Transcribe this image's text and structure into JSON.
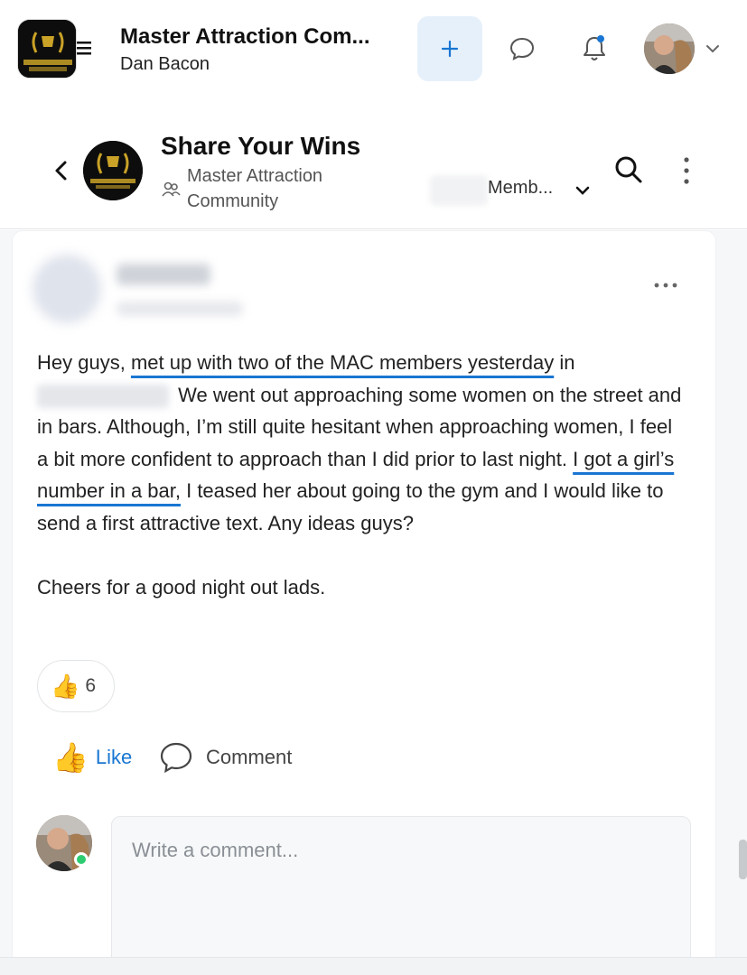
{
  "app": {
    "title": "Master Attraction Com...",
    "user_name": "Dan Bacon",
    "logo_text": "MASTER ATTRACTION COMMUNITY"
  },
  "group": {
    "title": "Share Your Wins",
    "community": "Master Attraction Community",
    "members_label": "Memb..."
  },
  "post": {
    "lines": {
      "p1_a": "Hey guys, ",
      "p1_hl1": "met up with two of the MAC members yesterday",
      "p1_b": " in",
      "p1_c": " We went out approaching some women on the street and in bars. Although, I’m still quite hesitant when approaching women, I feel a bit more confident to approach than I did prior to last night. ",
      "p1_hl2": "I got a girl’s number in a bar,",
      "p1_d": " I teased her about going to the gym and I would like to send a first attractive text. Any ideas guys?",
      "p2": "Cheers for a good night out lads."
    },
    "reaction_emoji": "👍",
    "reaction_count": "6"
  },
  "actions": {
    "like_emoji": "👍",
    "like_label": "Like",
    "comment_label": "Comment"
  },
  "comment": {
    "placeholder": "Write a comment..."
  },
  "colors": {
    "accent": "#1976d2",
    "plus_bg": "#e6f0fb",
    "online": "#2ecc71"
  }
}
